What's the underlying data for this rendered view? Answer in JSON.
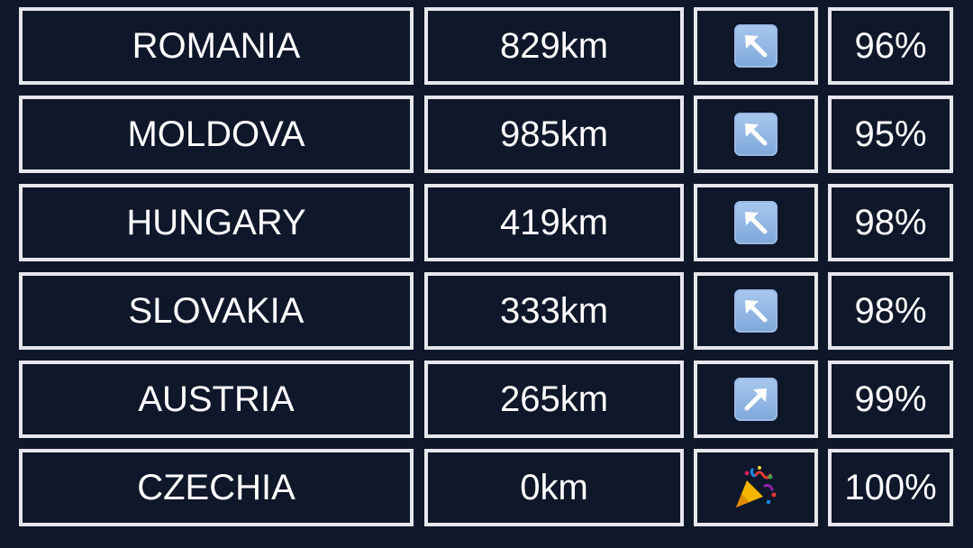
{
  "guesses": [
    {
      "country": "ROMANIA",
      "distance": "829km",
      "direction": "up-left",
      "direction_icon": "arrow-up-left-icon",
      "proximity": "96%"
    },
    {
      "country": "MOLDOVA",
      "distance": "985km",
      "direction": "up-left",
      "direction_icon": "arrow-up-left-icon",
      "proximity": "95%"
    },
    {
      "country": "HUNGARY",
      "distance": "419km",
      "direction": "up-left",
      "direction_icon": "arrow-up-left-icon",
      "proximity": "98%"
    },
    {
      "country": "SLOVAKIA",
      "distance": "333km",
      "direction": "up-left",
      "direction_icon": "arrow-up-left-icon",
      "proximity": "98%"
    },
    {
      "country": "AUSTRIA",
      "distance": "265km",
      "direction": "up-right",
      "direction_icon": "arrow-up-right-icon",
      "proximity": "99%"
    },
    {
      "country": "CZECHIA",
      "distance": "0km",
      "direction": "correct",
      "direction_icon": "party-popper-icon",
      "proximity": "100%"
    }
  ],
  "colors": {
    "background": "#0f172a",
    "cell_border": "#e5e7eb",
    "text": "#ffffff",
    "arrow_tile": "#8fb4e3"
  }
}
